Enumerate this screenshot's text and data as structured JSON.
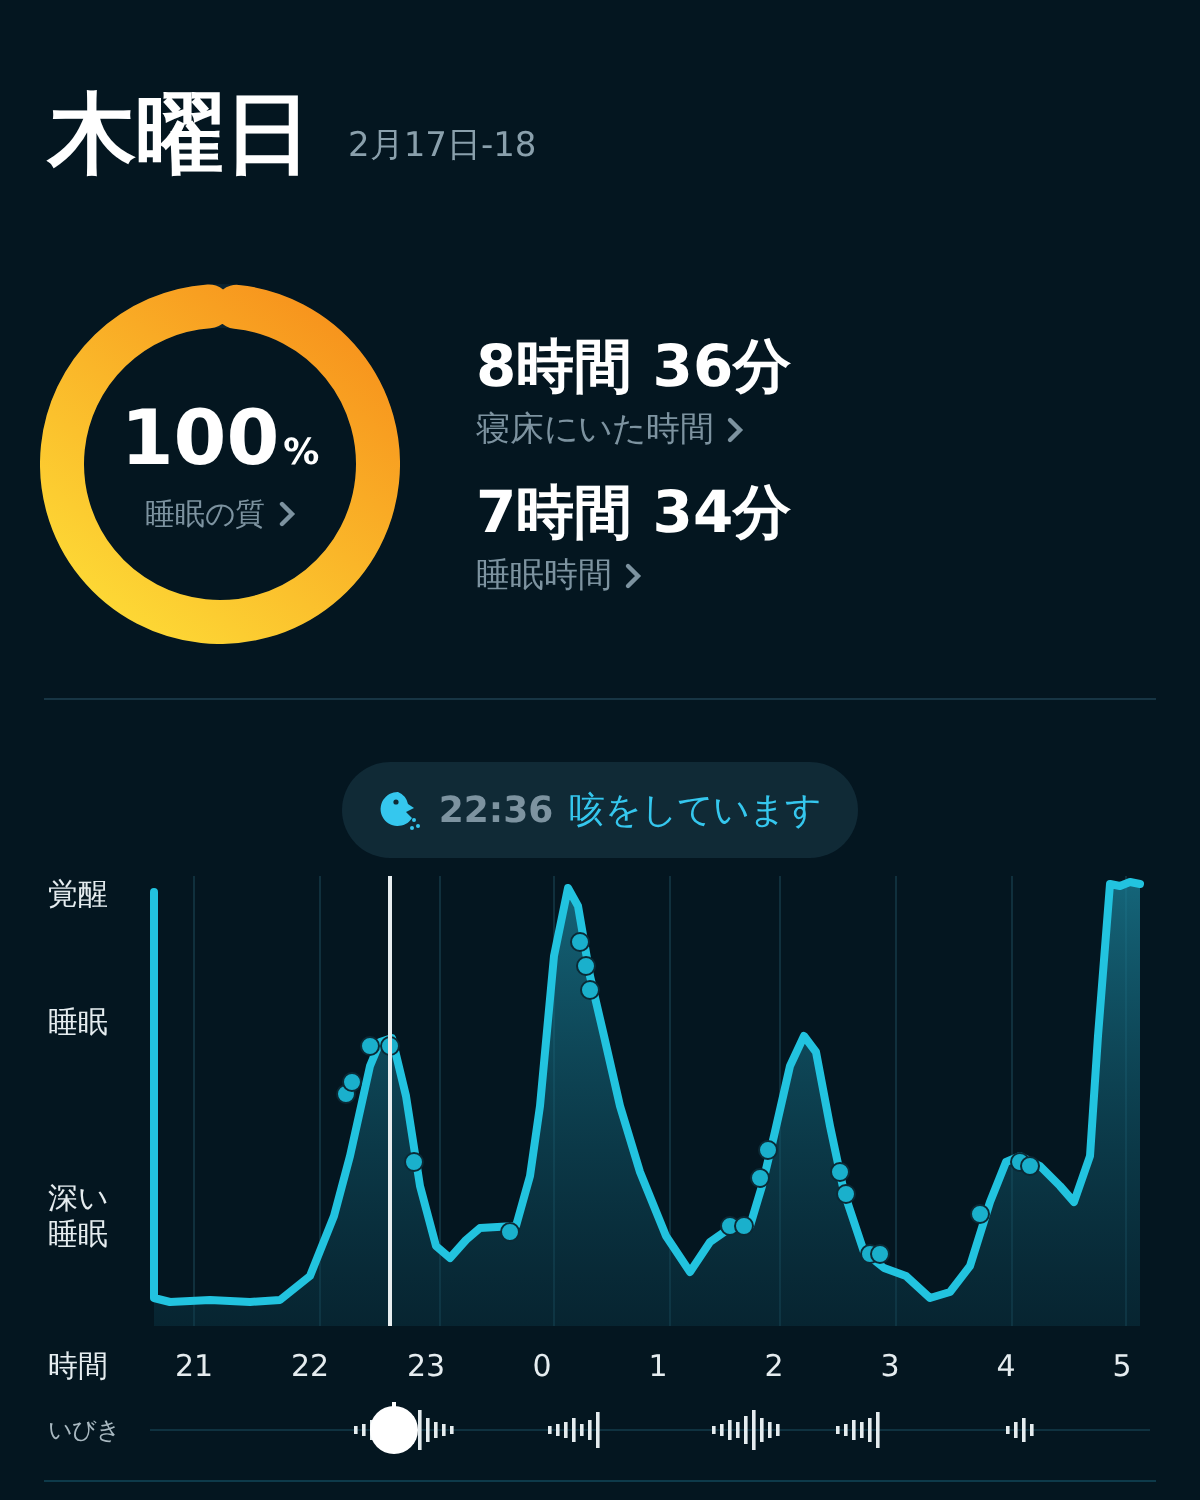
{
  "header": {
    "title": "木曜日",
    "date": "2月17日-18"
  },
  "quality": {
    "value": "100",
    "unit": "%",
    "label": "睡眠の質"
  },
  "stats": [
    {
      "value": "8時間 36分",
      "label": "寝床にいた時間"
    },
    {
      "value": "7時間 34分",
      "label": "睡眠時間"
    }
  ],
  "event": {
    "time": "22:36",
    "text": "咳をしています"
  },
  "chart": {
    "y_labels": [
      "覚醒",
      "睡眠",
      "深い睡眠"
    ],
    "x_axis_label": "時間",
    "x_labels": [
      "21",
      "22",
      "23",
      "0",
      "1",
      "2",
      "3",
      "4",
      "5"
    ]
  },
  "snoring": {
    "label": "いびき"
  }
}
